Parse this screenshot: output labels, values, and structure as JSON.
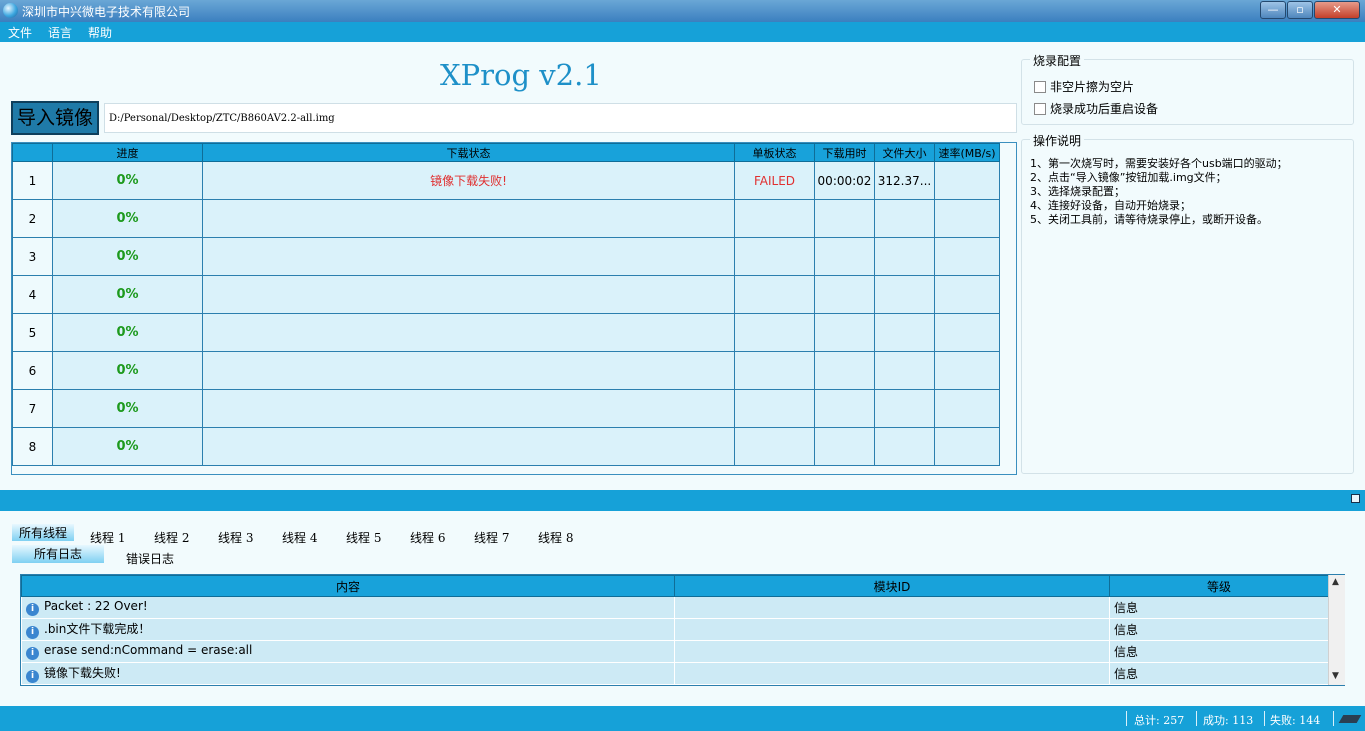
{
  "window": {
    "title": "深圳市中兴微电子技术有限公司",
    "min_label": "—",
    "max_label": "▫",
    "close_label": "✕"
  },
  "menu": [
    "文件",
    "语言",
    "帮助"
  ],
  "app_title": "XProg v2.1",
  "import_button": "导入镜像",
  "image_path": "D:/Personal/Desktop/ZTC/B860AV2.2-all.img",
  "grid": {
    "headers": [
      "",
      "进度",
      "下载状态",
      "单板状态",
      "下载用时",
      "文件大小",
      "速率(MB/s)"
    ],
    "rows": [
      {
        "no": "1",
        "progress": "0%",
        "status": "镜像下载失败!",
        "board": "FAILED",
        "time": "00:00:02",
        "size": "312.37...",
        "rate": ""
      },
      {
        "no": "2",
        "progress": "0%",
        "status": "",
        "board": "",
        "time": "",
        "size": "",
        "rate": ""
      },
      {
        "no": "3",
        "progress": "0%",
        "status": "",
        "board": "",
        "time": "",
        "size": "",
        "rate": ""
      },
      {
        "no": "4",
        "progress": "0%",
        "status": "",
        "board": "",
        "time": "",
        "size": "",
        "rate": ""
      },
      {
        "no": "5",
        "progress": "0%",
        "status": "",
        "board": "",
        "time": "",
        "size": "",
        "rate": ""
      },
      {
        "no": "6",
        "progress": "0%",
        "status": "",
        "board": "",
        "time": "",
        "size": "",
        "rate": ""
      },
      {
        "no": "7",
        "progress": "0%",
        "status": "",
        "board": "",
        "time": "",
        "size": "",
        "rate": ""
      },
      {
        "no": "8",
        "progress": "0%",
        "status": "",
        "board": "",
        "time": "",
        "size": "",
        "rate": ""
      }
    ]
  },
  "burn_config": {
    "title": "烧录配置",
    "options": [
      "非空片擦为空片",
      "烧录成功后重启设备"
    ]
  },
  "instructions": {
    "title": "操作说明",
    "lines": [
      "1、第一次烧写时，需要安装好各个usb端口的驱动；",
      "2、点击“导入镜像”按钮加载.img文件；",
      "3、选择烧录配置；",
      "4、连接好设备，自动开始烧录；",
      "5、关闭工具前，请等待烧录停止，或断开设备。"
    ]
  },
  "thread_tabs": [
    "所有线程",
    "线程 1",
    "线程 2",
    "线程 3",
    "线程 4",
    "线程 5",
    "线程 6",
    "线程 7",
    "线程 8"
  ],
  "log_tabs": [
    "所有日志",
    "错误日志"
  ],
  "log": {
    "headers": [
      "内容",
      "模块ID",
      "等级"
    ],
    "rows": [
      {
        "content": "Packet : 22 Over!",
        "module": "",
        "level": "信息"
      },
      {
        "content": ".bin文件下载完成！",
        "module": "",
        "level": "信息"
      },
      {
        "content": "erase send:nCommand = erase:all",
        "module": "",
        "level": "信息"
      },
      {
        "content": "镜像下载失败!",
        "module": "",
        "level": "信息"
      }
    ]
  },
  "status": {
    "total": "总计: 257",
    "success": "成功: 113",
    "fail": "失败: 144"
  }
}
